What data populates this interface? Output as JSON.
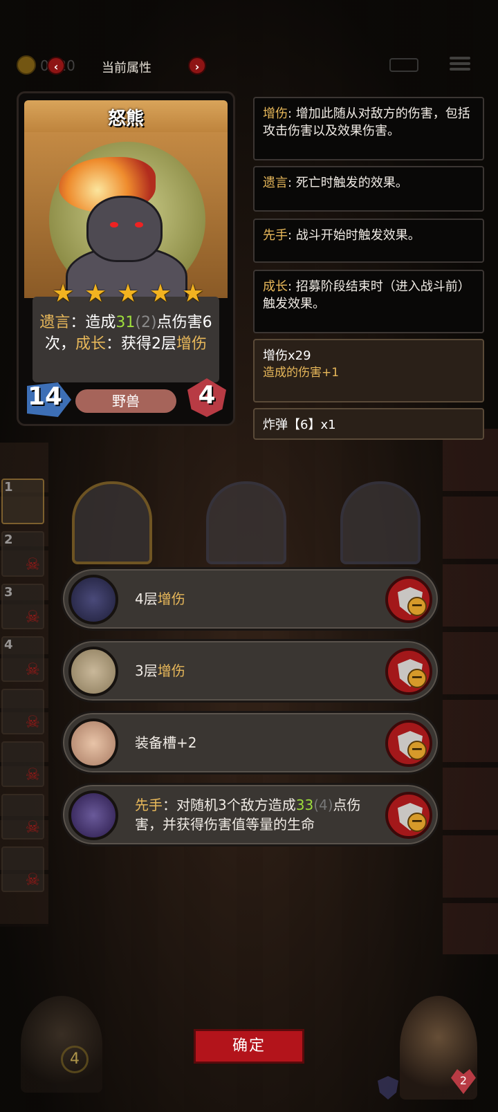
{
  "header": {
    "title": "当前属性",
    "prev_icon": "‹",
    "next_icon": "›",
    "coin_value": "0020"
  },
  "card": {
    "name": "怒熊",
    "stars": 5,
    "desc": {
      "kw1": "遗言",
      "p1": "：造成",
      "dmg": "31",
      "dmg_extra": "(2)",
      "p2": "点伤害6次，",
      "kw2": "成长",
      "p3": "：获得2层",
      "kw3": "增伤"
    },
    "attack": "14",
    "health": "4",
    "tribe": "野兽"
  },
  "keywords": [
    {
      "k": "增伤",
      "text": ": 增加此随从对敌方的伤害，包括攻击伤害以及效果伤害。"
    },
    {
      "k": "遗言",
      "text": ": 死亡时触发的效果。"
    },
    {
      "k": "先手",
      "text": ": 战斗开始时触发效果。"
    },
    {
      "k": "成长",
      "text": ": 招募阶段结束时（进入战斗前）触发效果。"
    }
  ],
  "buffs": [
    {
      "title": "增伤x29",
      "sub": "造成的伤害+1"
    },
    {
      "title": "炸弹【6】x1",
      "sub": ""
    }
  ],
  "team": [
    {
      "idx": "1"
    },
    {
      "idx": "2"
    },
    {
      "idx": "3"
    },
    {
      "idx": "4"
    },
    {
      "idx": ""
    },
    {
      "idx": ""
    },
    {
      "idx": ""
    },
    {
      "idx": ""
    }
  ],
  "equipment": [
    {
      "pre": "4层",
      "kw": "增伤",
      "post": ""
    },
    {
      "pre": "3层",
      "kw": "增伤",
      "post": ""
    },
    {
      "pre": "装备槽+2",
      "kw": "",
      "post": ""
    },
    {
      "kw": "先手",
      "p1": "：对随机3个敌方造成",
      "num": "33",
      "num_dim": "(4)",
      "p2": "点伤害，并获得伤害值等量的生命"
    }
  ],
  "footer": {
    "confirm": "确定",
    "level": "4",
    "hero_hp": "2"
  },
  "colors": {
    "keyword": "#e8b85a",
    "number": "#9ede3c",
    "confirm": "#b3141b"
  }
}
